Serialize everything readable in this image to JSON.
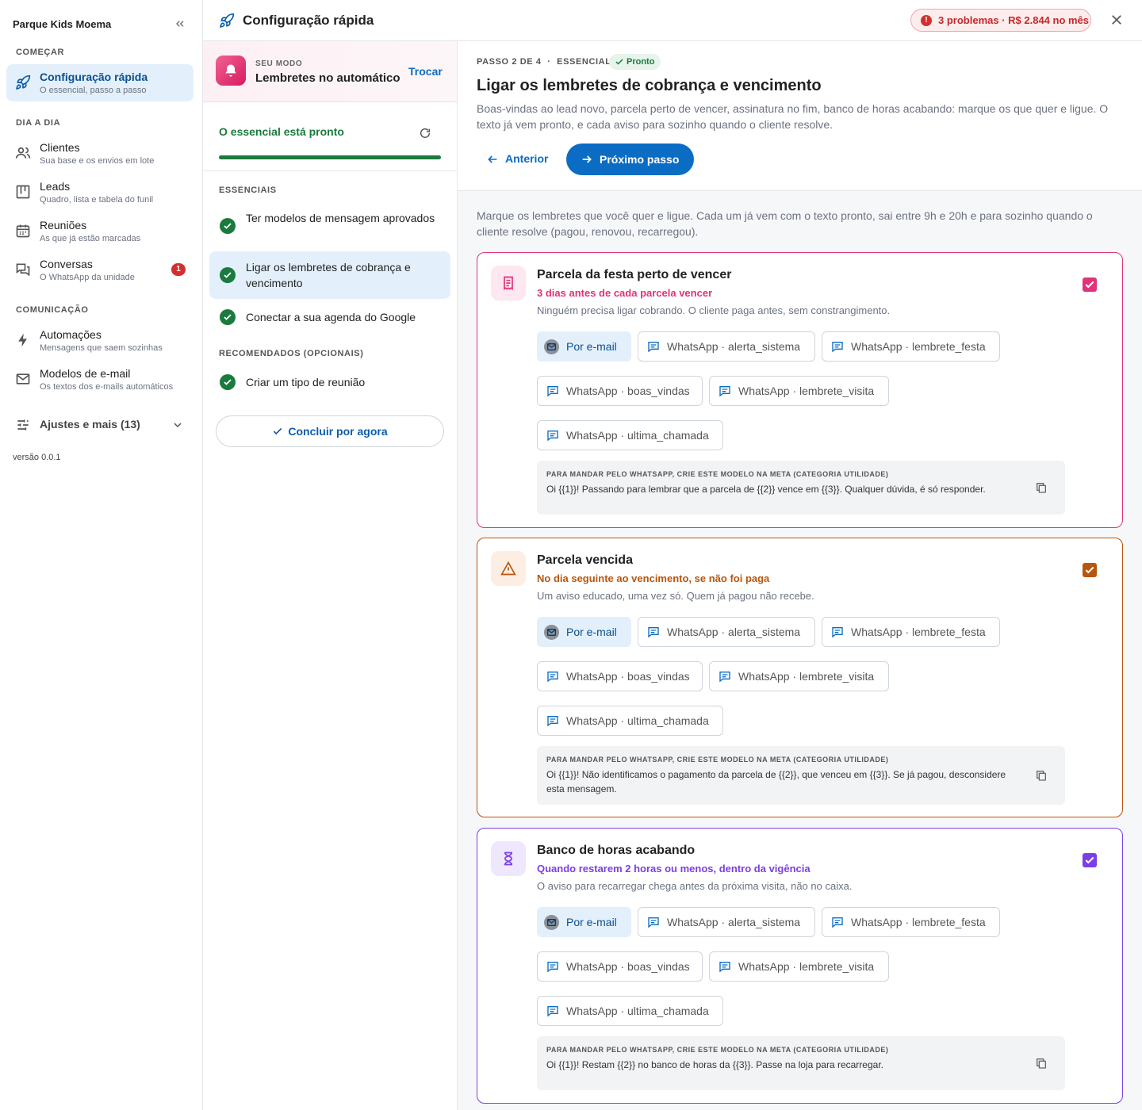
{
  "sidebar": {
    "brand": "Parque Kids Moema",
    "sections": {
      "start": "COMEÇAR",
      "daily": "DIA A DIA",
      "communication": "COMUNICAÇÃO"
    },
    "items": [
      {
        "title": "Configuração rápida",
        "subtitle": "O essencial, passo a passo"
      },
      {
        "title": "Clientes",
        "subtitle": "Sua base e os envios em lote"
      },
      {
        "title": "Leads",
        "subtitle": "Quadro, lista e tabela do funil"
      },
      {
        "title": "Reuniões",
        "subtitle": "As que já estão marcadas"
      },
      {
        "title": "Conversas",
        "subtitle": "O WhatsApp da unidade",
        "badge": "1"
      },
      {
        "title": "Automações",
        "subtitle": "Mensagens que saem sozinhas"
      },
      {
        "title": "Modelos de e-mail",
        "subtitle": "Os textos dos e-mails automáticos"
      }
    ],
    "settings": "Ajustes e mais (13)",
    "version": "versão 0.0.1"
  },
  "topbar": {
    "title": "Configuração rápida",
    "alert": "3 problemas · R$ 2.844 no mês",
    "alert_icon": "!"
  },
  "mode": {
    "label": "SEU MODO",
    "value": "Lembretes no automático",
    "switch": "Trocar"
  },
  "progress": {
    "status": "O essencial está pronto",
    "fraction": 1.0
  },
  "steps": {
    "essentials_label": "ESSENCIAIS",
    "recommended_label": "RECOMENDADOS (OPCIONAIS)",
    "items": [
      "Ter modelos de mensagem aprovados",
      "Ligar os lembretes de cobrança e vencimento",
      "Conectar a sua agenda do Google",
      "Criar um tipo de reunião"
    ],
    "finish": "Concluir por agora"
  },
  "main": {
    "step": "PASSO 2 DE 4",
    "sep": "·",
    "category": "ESSENCIAL",
    "status": "Pronto",
    "title": "Ligar os lembretes de cobrança e vencimento",
    "description": "Boas-vindas ao lead novo, parcela perto de vencer, assinatura no fim, banco de horas acabando: marque os que quer e ligue. O texto já vem pronto, e cada aviso para sozinho quando o cliente resolve.",
    "prev": "Anterior",
    "next": "Próximo passo",
    "intro": "Marque os lembretes que você quer e ligue. Cada um já vem com o texto pronto, sai entre 9h e 20h e para sozinho quando o cliente resolve (pagou, renovou, recarregou)."
  },
  "channels": [
    "Por e-mail",
    "WhatsApp · alerta_sistema",
    "WhatsApp · lembrete_festa",
    "WhatsApp · boas_vindas",
    "WhatsApp · lembrete_visita",
    "WhatsApp · ultima_chamada"
  ],
  "template_label": "PARA MANDAR PELO WHATSAPP, CRIE ESTE MODELO NA META (CATEGORIA UTILIDADE)",
  "reminders": [
    {
      "title": "Parcela da festa perto de vencer",
      "subtitle": "3 dias antes de cada parcela vencer",
      "description": "Ninguém precisa ligar cobrando. O cliente paga antes, sem constrangimento.",
      "template": "Oi {{1}}! Passando para lembrar que a parcela de {{2}} vence em {{3}}. Qualquer dúvida, é só responder.",
      "color": "#e0337a",
      "tint": "#fde7f0",
      "icon": "receipt-icon",
      "checked": true
    },
    {
      "title": "Parcela vencida",
      "subtitle": "No dia seguinte ao vencimento, se não foi paga",
      "description": "Um aviso educado, uma vez só. Quem já pagou não recebe.",
      "template": "Oi {{1}}! Não identificamos o pagamento da parcela de {{2}}, que venceu em {{3}}. Se já pagou, desconsidere esta mensagem.",
      "color": "#b8560e",
      "tint": "#fdeee3",
      "icon": "warning-icon",
      "checked": true
    },
    {
      "title": "Banco de horas acabando",
      "subtitle": "Quando restarem 2 horas ou menos, dentro da vigência",
      "description": "O aviso para recarregar chega antes da próxima visita, não no caixa.",
      "template": "Oi {{1}}! Restam {{2}} no banco de horas da {{3}}. Passe na loja para recarregar.",
      "color": "#7b3fe4",
      "tint": "#efe7fd",
      "icon": "hourglass-icon",
      "checked": true
    }
  ]
}
